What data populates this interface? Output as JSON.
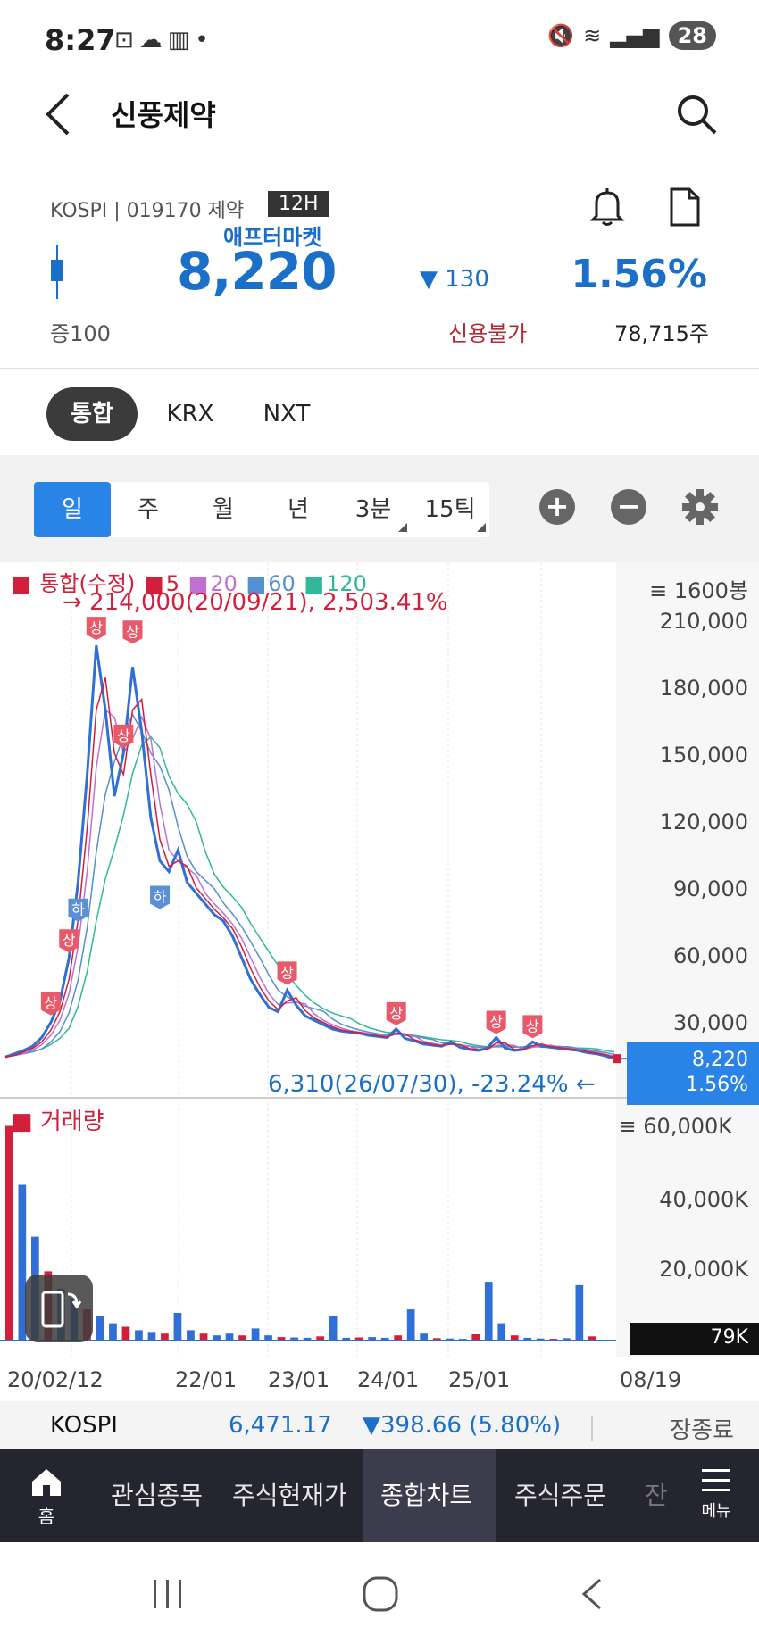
{
  "status_bar": {
    "time": "8:27",
    "battery": "28"
  },
  "header": {
    "title": "신풍제약"
  },
  "quote": {
    "market": "KOSPI",
    "code": "019170",
    "sector": "제약",
    "badge": "12H",
    "session": "애프터마켓",
    "price": "8,220",
    "change": "▼ 130",
    "change_pct": "1.56%",
    "margin": "증100",
    "credit": "신용불가",
    "volume": "78,715주",
    "colors": {
      "down": "#1a6fc9",
      "up": "#d21f3c"
    }
  },
  "market_tabs": [
    {
      "label": "통합",
      "active": true
    },
    {
      "label": "KRX",
      "active": false
    },
    {
      "label": "NXT",
      "active": false
    }
  ],
  "period_tabs": [
    {
      "label": "일",
      "active": true
    },
    {
      "label": "주",
      "active": false
    },
    {
      "label": "월",
      "active": false
    },
    {
      "label": "년",
      "active": false
    },
    {
      "label": "3분",
      "active": false
    },
    {
      "label": "15틱",
      "active": false
    }
  ],
  "legend": {
    "main": "통합(수정)",
    "ma": [
      {
        "label": "5",
        "color": "#d21f3c"
      },
      {
        "label": "20",
        "color": "#c070d0"
      },
      {
        "label": "60",
        "color": "#5590d0"
      },
      {
        "label": "120",
        "color": "#30b89a"
      }
    ]
  },
  "chart_info": {
    "bars": "1600봉",
    "high_note": "→ 214,000(20/09/21), 2,503.41%",
    "low_note": "6,310(26/07/30), -23.24%  ←",
    "current_price": "8,220",
    "current_pct": "1.56%",
    "volume_title": "거래량",
    "current_volume": "79K",
    "limit_up_label": "상",
    "limit_down_label": "하"
  },
  "chart_data": {
    "type": "line",
    "price_axis": {
      "ticks": [
        "210,000",
        "180,000",
        "150,000",
        "120,000",
        "90,000",
        "60,000",
        "30,000"
      ],
      "values": [
        210000,
        180000,
        150000,
        120000,
        90000,
        60000,
        30000
      ],
      "ylim": [
        0,
        222000
      ]
    },
    "volume_axis": {
      "ticks": [
        "60,000K",
        "40,000K",
        "20,000K"
      ],
      "values": [
        60000,
        40000,
        20000
      ],
      "ylim": [
        0,
        66000
      ]
    },
    "x_labels": [
      "20/02/12",
      "22/01",
      "23/01",
      "24/01",
      "25/01",
      "08/19"
    ],
    "series": [
      {
        "name": "통합(수정)",
        "values": [
          9000,
          10500,
          12000,
          14000,
          18000,
          25000,
          35000,
          55000,
          90000,
          140000,
          200000,
          170000,
          130000,
          150000,
          190000,
          160000,
          120000,
          100000,
          95000,
          105000,
          90000,
          85000,
          80000,
          75000,
          72000,
          65000,
          55000,
          45000,
          38000,
          32000,
          30000,
          40000,
          33000,
          28000,
          26000,
          24000,
          22000,
          21000,
          20500,
          20000,
          19000,
          18500,
          18000,
          22000,
          17500,
          16500,
          15000,
          14500,
          14000,
          16000,
          13500,
          12500,
          12000,
          13000,
          18000,
          13000,
          12000,
          12500,
          16000,
          14000,
          13500,
          13000,
          12500,
          12000,
          11000,
          10500,
          9500,
          8220
        ]
      }
    ],
    "volume": [
      62000,
      45000,
      30000,
      20000,
      15000,
      12000,
      9000,
      7000,
      5000,
      4000,
      3000,
      2500,
      2000,
      8000,
      3000,
      2000,
      1500,
      2000,
      1500,
      3500,
      1500,
      1000,
      900,
      800,
      1200,
      7000,
      800,
      900,
      1000,
      800,
      1500,
      9000,
      2000,
      700,
      600,
      500,
      1800,
      17000,
      5000,
      1500,
      800,
      600,
      500,
      700,
      16000,
      1200,
      79
    ]
  },
  "ticker": {
    "name": "KOSPI",
    "value": "6,471.17",
    "change": "▼398.66 (5.80%)",
    "status": "장종료"
  },
  "bottom_nav": {
    "home": "홈",
    "items": [
      "관심종목",
      "주식현재가",
      "종합차트",
      "주식주문",
      "잔"
    ],
    "active": "종합차트",
    "menu": "메뉴"
  }
}
